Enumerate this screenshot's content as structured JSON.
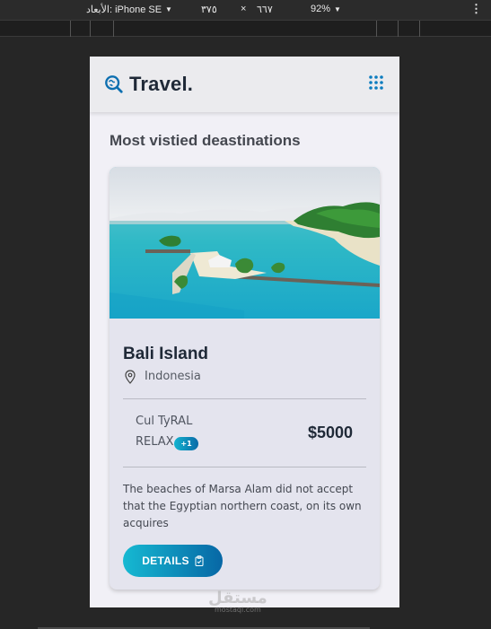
{
  "devtools": {
    "device_label": "الأبعاد: iPhone SE",
    "width_value": "٣٧٥",
    "times": "×",
    "height_value": "٦٦٧",
    "zoom_value": "92%",
    "dropdown_icon": "triangle-down",
    "more_icon": "vertical-ellipsis"
  },
  "app": {
    "brand": "Travel.",
    "logo_icon": "search-globe",
    "menu_icon": "grid-dots",
    "accent": "#0d7cbf",
    "gradient_start": "#16b9d2",
    "gradient_end": "#0767a5"
  },
  "section": {
    "title": "Most vistied deastinations"
  },
  "card": {
    "place": "Bali Island",
    "country": "Indonesia",
    "tag_line1": "Cul TyRAL",
    "tag_line2": "RELAX",
    "badge": "+1",
    "price": "$5000",
    "description": "The beaches of Marsa Alam did not accept that the Egyptian northern coast, on its own acquires",
    "button_label": "DETAILS"
  },
  "watermark": {
    "arabic": "مستقل",
    "url": "mostaql.com"
  }
}
